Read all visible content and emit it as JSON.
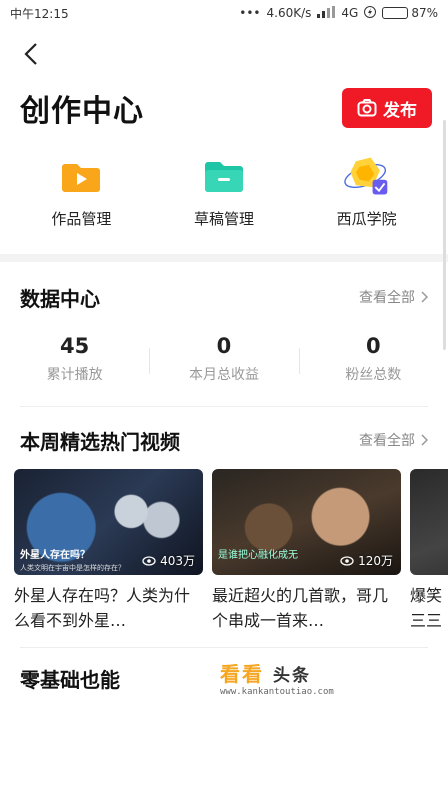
{
  "status_bar": {
    "time": "中午12:15",
    "network_speed": "4.60K/s",
    "network_type": "4G",
    "battery": "87%",
    "battery_level": 0.87
  },
  "header": {
    "title": "创作中心",
    "publish_label": "发布"
  },
  "tools": [
    {
      "label": "作品管理",
      "icon": "folder-orange-icon"
    },
    {
      "label": "草稿管理",
      "icon": "folder-teal-icon"
    },
    {
      "label": "西瓜学院",
      "icon": "xigua-academy-icon"
    }
  ],
  "data_center": {
    "title": "数据中心",
    "see_all": "查看全部",
    "stats": [
      {
        "value": "45",
        "label": "累计播放"
      },
      {
        "value": "0",
        "label": "本月总收益"
      },
      {
        "value": "0",
        "label": "粉丝总数"
      }
    ]
  },
  "hot_videos": {
    "title": "本周精选热门视频",
    "see_all": "查看全部",
    "videos": [
      {
        "title": "外星人存在吗？人类为什么看不到外星…",
        "views": "403万",
        "thumb_caption": "外星人存在吗？",
        "thumb_sub": "人类文明在宇宙中是怎样的存在？"
      },
      {
        "title": "最近超火的几首歌，哥几个串成一首来…",
        "views": "120万",
        "thumb_caption": "是谁把心融化成无",
        "thumb_sub": ""
      },
      {
        "title": "爆笑三三",
        "views": "",
        "thumb_caption": "",
        "thumb_sub": ""
      }
    ]
  },
  "bottom_section": {
    "title": "零基础也能"
  },
  "watermark": {
    "main": "看看",
    "suffix": "头条",
    "url": "www.kankantoutiao.com"
  }
}
